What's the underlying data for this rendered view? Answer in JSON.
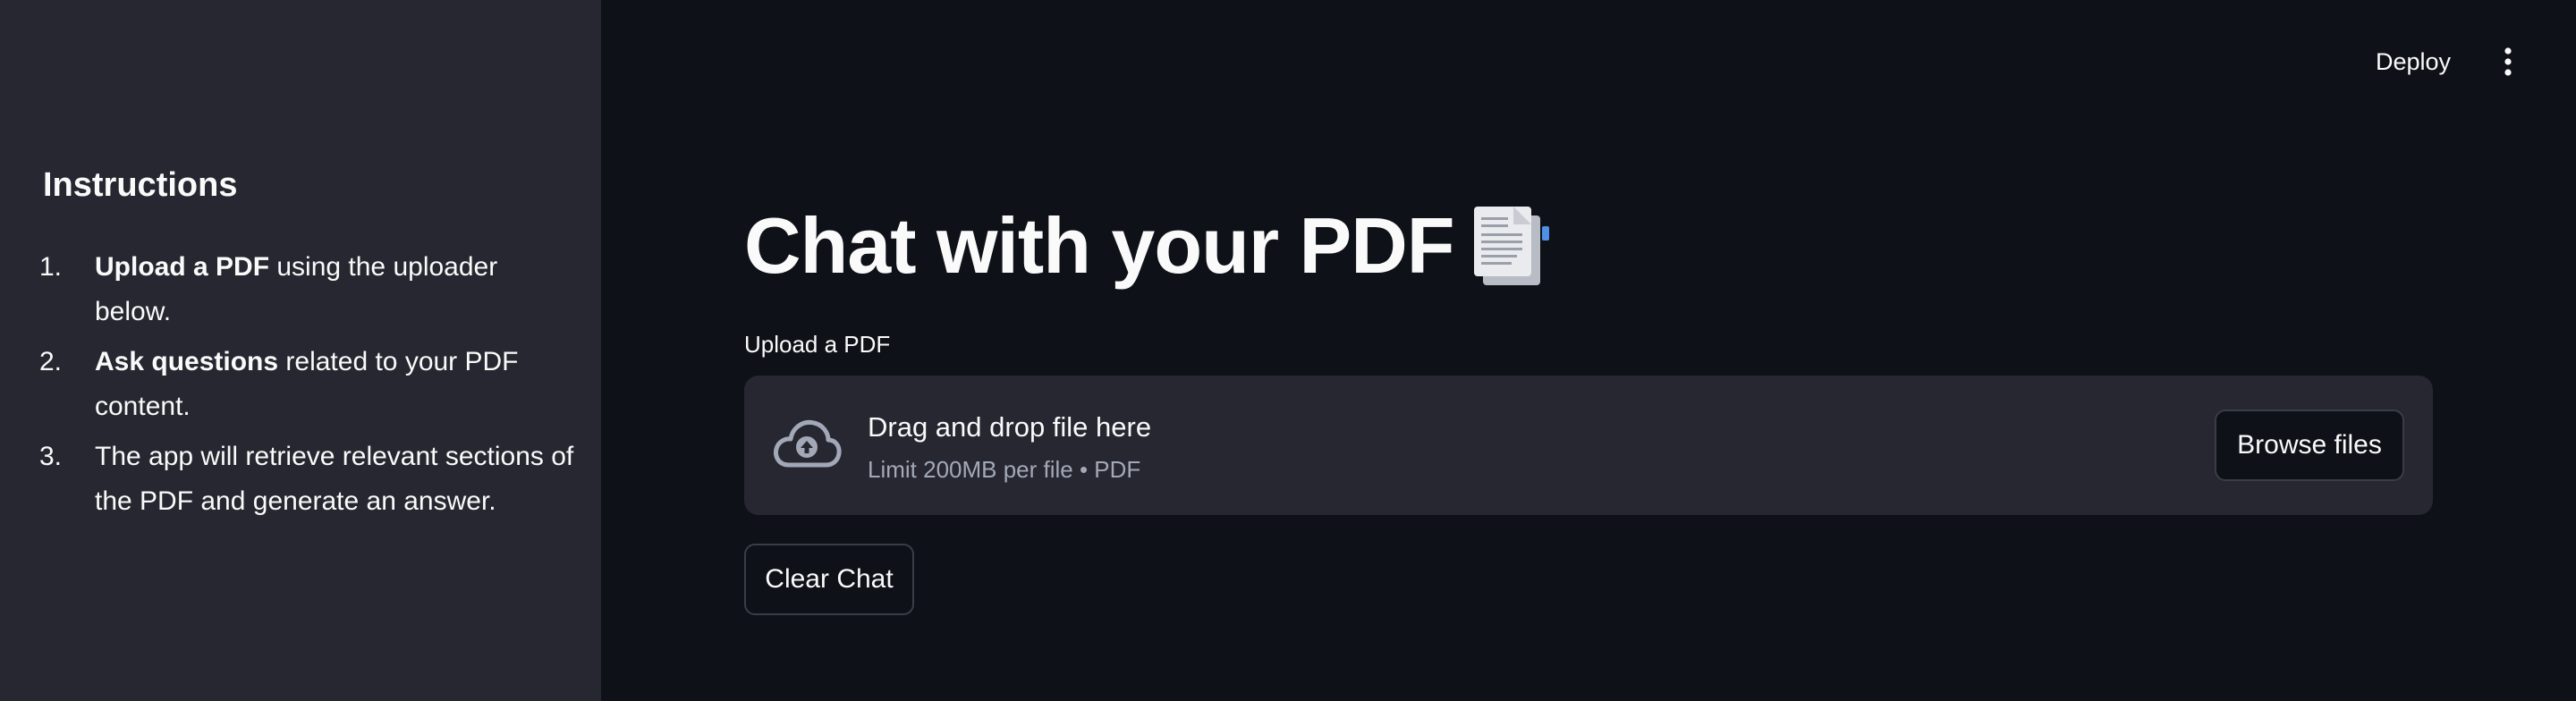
{
  "sidebar": {
    "title": "Instructions",
    "items": [
      {
        "num": "1.",
        "bold": "Upload a PDF",
        "text": " using the uploader below."
      },
      {
        "num": "2.",
        "bold": "Ask questions",
        "text": " related to your PDF content."
      },
      {
        "num": "3.",
        "bold": "",
        "text": "The app will retrieve relevant sections of the PDF and generate an answer."
      }
    ]
  },
  "header": {
    "deploy_label": "Deploy",
    "menu_icon": "vertical-ellipsis-icon"
  },
  "main": {
    "title": "Chat with your PDF",
    "title_icon": "document-emoji-icon",
    "uploader": {
      "label": "Upload a PDF",
      "drop_text": "Drag and drop file here",
      "limit_text": "Limit 200MB per file • PDF",
      "browse_label": "Browse files",
      "icon": "cloud-upload-icon"
    },
    "clear_label": "Clear Chat"
  },
  "colors": {
    "background": "#0e1117",
    "sidebar": "#262730",
    "dropzone": "#262730",
    "text": "#fafafa",
    "muted_text": "#a3a8b8",
    "button_border": "#3a3d48"
  }
}
